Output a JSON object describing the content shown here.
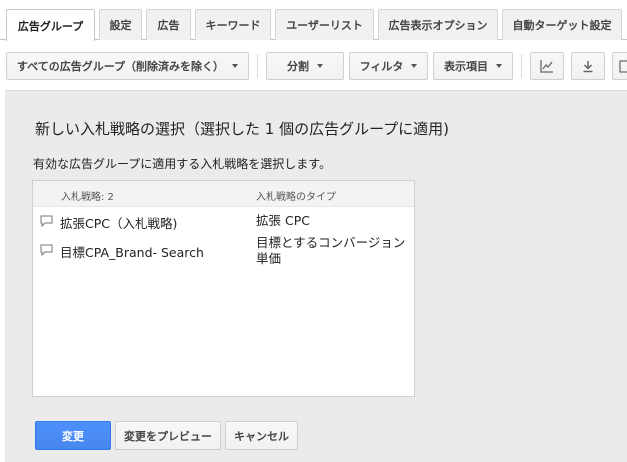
{
  "tabs": [
    {
      "label": "広告グループ",
      "active": true
    },
    {
      "label": "設定",
      "active": false
    },
    {
      "label": "広告",
      "active": false
    },
    {
      "label": "キーワード",
      "active": false
    },
    {
      "label": "ユーザーリスト",
      "active": false
    },
    {
      "label": "広告表示オプション",
      "active": false
    },
    {
      "label": "自動ターゲット設定",
      "active": false
    }
  ],
  "toolbar": {
    "filter_dropdown": "すべての広告グループ（削除済みを除く）",
    "segment": "分割",
    "filter": "フィルタ",
    "columns": "表示項目",
    "graph_icon": "line-chart-icon",
    "download_icon": "download-icon"
  },
  "dialog": {
    "title": "新しい入札戦略の選択（選択した 1 個の広告グループに適用)",
    "subtitle": "有効な広告グループに適用する入札戦略を選択します。",
    "list": {
      "col_strategy": "入札戦略: 2",
      "col_type": "入札戦略のタイプ",
      "rows": [
        {
          "name": "拡張CPC（入札戦略)",
          "type": "拡張 CPC"
        },
        {
          "name": "目標CPA_Brand- Search",
          "type": "目標とするコンバージョン単価"
        }
      ]
    },
    "buttons": {
      "apply": "変更",
      "preview": "変更をプレビュー",
      "cancel": "キャンセル"
    }
  }
}
